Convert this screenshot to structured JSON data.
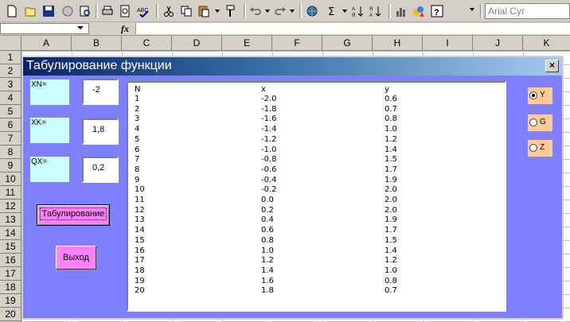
{
  "toolbar": {
    "icons": [
      "new-icon",
      "open-icon",
      "save-icon",
      "permission-icon",
      "print-preview-icon",
      "print-icon",
      "print-preview2-icon",
      "spelling-icon",
      "cut-icon",
      "copy-icon",
      "paste-icon",
      "format-painter-icon",
      "undo-icon",
      "redo-icon",
      "hyperlink-icon",
      "autosum-icon",
      "sort-ascending-icon",
      "sort-descending-icon",
      "chart-wizard-icon",
      "drawing-icon",
      "help-icon"
    ],
    "font_name": "Arial Cyr"
  },
  "formula_bar": {
    "fx_label": "fx",
    "name_box": "",
    "value": ""
  },
  "columns": [
    "A",
    "B",
    "C",
    "D",
    "E",
    "F",
    "G",
    "H",
    "I",
    "J",
    "K"
  ],
  "rows": [
    "1",
    "2",
    "3",
    "4",
    "5",
    "6",
    "7",
    "8",
    "9",
    "10",
    "11",
    "12",
    "13",
    "14",
    "15",
    "16",
    "17",
    "18",
    "19",
    "20"
  ],
  "form": {
    "title": "Табулирование функции",
    "close_label": "×",
    "xn_label": "XN=",
    "xn_value": "-2",
    "xk_label": "XK=",
    "xk_value": "1,8",
    "qx_label": "QX=",
    "qx_value": "0,2",
    "tab_button": "Табулирование",
    "exit_button": "Выход",
    "options": [
      {
        "label": "Y",
        "selected": true
      },
      {
        "label": "G",
        "selected": false
      },
      {
        "label": "Z",
        "selected": false
      }
    ],
    "list": {
      "headers": [
        "N",
        "x",
        "y"
      ],
      "rows": [
        [
          "1",
          "-2.0",
          "0.6"
        ],
        [
          "2",
          "-1.8",
          "0.7"
        ],
        [
          "3",
          "-1.6",
          "0.8"
        ],
        [
          "4",
          "-1.4",
          "1.0"
        ],
        [
          "5",
          "-1.2",
          "1.2"
        ],
        [
          "6",
          "-1.0",
          "1.4"
        ],
        [
          "7",
          "-0.8",
          "1.5"
        ],
        [
          "8",
          "-0.6",
          "1.7"
        ],
        [
          "9",
          "-0.4",
          "1.9"
        ],
        [
          "10",
          "-0.2",
          "2.0"
        ],
        [
          "11",
          "0.0",
          "2.0"
        ],
        [
          "12",
          "0.2",
          "2.0"
        ],
        [
          "13",
          "0.4",
          "1.9"
        ],
        [
          "14",
          "0.6",
          "1.7"
        ],
        [
          "15",
          "0.8",
          "1.5"
        ],
        [
          "16",
          "1.0",
          "1.4"
        ],
        [
          "17",
          "1.2",
          "1.2"
        ],
        [
          "18",
          "1.4",
          "1.0"
        ],
        [
          "19",
          "1.6",
          "0.8"
        ],
        [
          "20",
          "1.8",
          "0.7"
        ]
      ]
    }
  },
  "colors": {
    "form_bg": "#8080ff",
    "label_bg": "#ccffff",
    "button_bg": "#ff80ff",
    "option_bg": "#ffcc99"
  }
}
